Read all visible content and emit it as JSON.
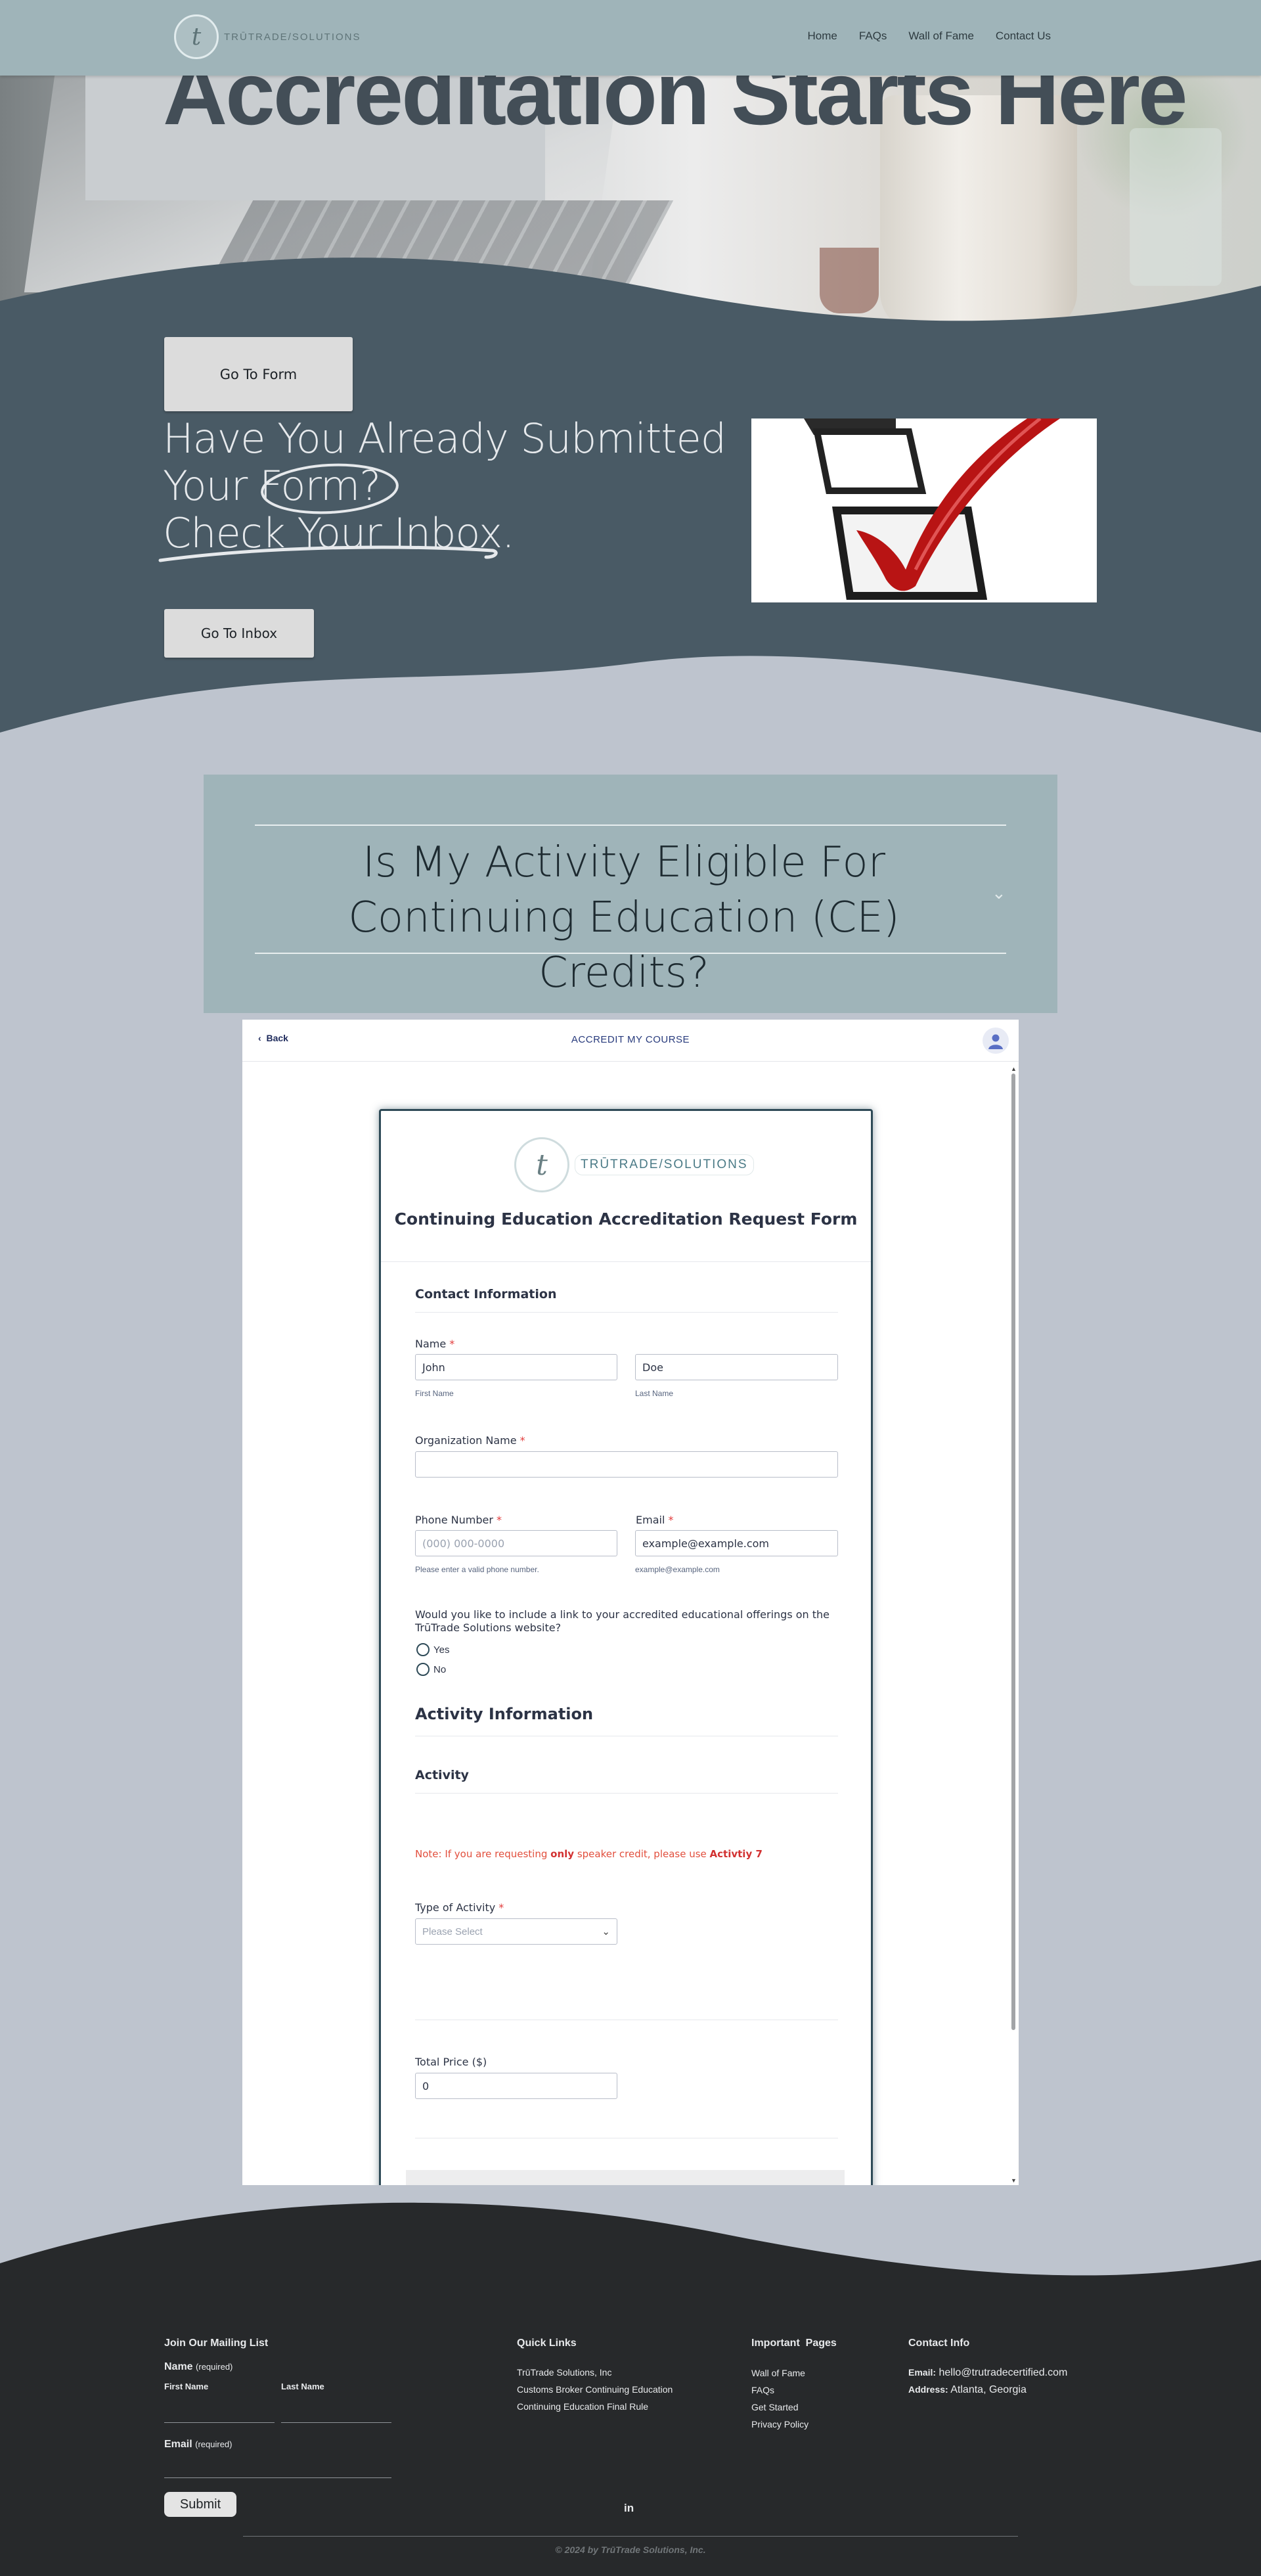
{
  "header": {
    "logo_text": "TRŪTRADE/SOLUTIONS",
    "nav": [
      "Home",
      "FAQs",
      "Wall of Fame",
      "Contact Us"
    ]
  },
  "hero": {
    "title": "Accreditation Starts Here"
  },
  "cta": {
    "go_to_form": "Go To Form",
    "submitted_lines": [
      "Have You Already Submitted",
      "Your Form?",
      "Check Your Inbox."
    ],
    "go_to_inbox": "Go To Inbox"
  },
  "accordion": {
    "title": "Is My Activity Eligible For Continuing Education (CE) Credits?",
    "chevron": "chevron-down-icon"
  },
  "embed": {
    "back_label": "Back",
    "title": "ACCREDIT MY COURSE",
    "form": {
      "logo_text": "TRŪTRADE/SOLUTIONS",
      "title": "Continuing Education Accreditation Request Form",
      "contact_section": "Contact Information",
      "name_label": "Name",
      "first_name_value": "John",
      "first_name_sub": "First Name",
      "last_name_value": "Doe",
      "last_name_sub": "Last Name",
      "org_label": "Organization Name",
      "phone_label": "Phone Number",
      "phone_placeholder": "(000) 000-0000",
      "phone_sub": "Please enter a valid phone number.",
      "email_label": "Email",
      "email_placeholder": "example@example.com",
      "email_sub": "example@example.com",
      "link_question": "Would you like to include a link to your accredited educational offerings on the TrūTrade Solutions website?",
      "radio_yes": "Yes",
      "radio_no": "No",
      "activity_section": "Activity Information",
      "activity_sub": "Activity",
      "note_prefix": "Note: If you are requesting ",
      "note_bold": "only",
      "note_middle": " speaker credit, please use ",
      "note_link": "Activtiy 7",
      "type_label": "Type of Activity",
      "type_placeholder": "Please Select",
      "price_label": "Total Price ($)",
      "price_value": "0"
    }
  },
  "footer": {
    "mailing_title": "Join Our Mailing List",
    "name_label": "Name",
    "required": "(required)",
    "first_name": "First Name",
    "last_name": "Last Name",
    "email_label": "Email",
    "submit": "Submit",
    "quick_links_title": "Quick Links",
    "quick_links": [
      "TrūTrade Solutions, Inc",
      "Customs Broker Continuing Education",
      "Continuing Education Final Rule"
    ],
    "pages_title": "Important  Pages",
    "pages": [
      "Wall of Fame",
      "FAQs",
      "Get Started",
      "Privacy Policy"
    ],
    "contact_title": "Contact Info",
    "email_key": "Email:",
    "email_value": "hello@trutradecertified.com",
    "address_key": "Address:",
    "address_value": "Atlanta, Georgia",
    "social": "in",
    "copyright": "© 2024 by TrūTrade Solutions, Inc."
  },
  "colors": {
    "header_bg": "#9fb4b9",
    "dark_section": "#495a65",
    "page_bg": "#bec4ce",
    "footer_bg": "#27292b",
    "required": "#e23b3b"
  }
}
